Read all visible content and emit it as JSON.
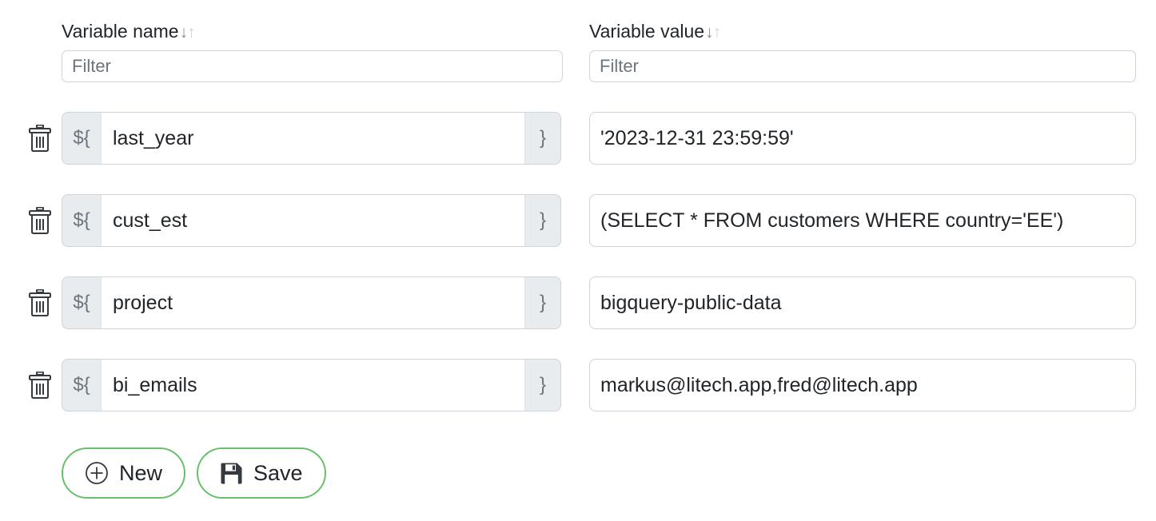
{
  "columns": {
    "name": {
      "header": "Variable name",
      "sort_down": "↓",
      "sort_up": "↑",
      "filter_placeholder": "Filter",
      "filter_value": ""
    },
    "value": {
      "header": "Variable value",
      "sort_down": "↓",
      "sort_up": "↑",
      "filter_placeholder": "Filter",
      "filter_value": ""
    }
  },
  "addons": {
    "prefix": "${",
    "suffix": "}"
  },
  "rows": [
    {
      "delete_icon": "trash-icon",
      "name": "last_year",
      "value": "'2023-12-31 23:59:59'"
    },
    {
      "delete_icon": "trash-icon",
      "name": "cust_est",
      "value": "(SELECT * FROM customers WHERE country='EE')"
    },
    {
      "delete_icon": "trash-icon",
      "name": "project",
      "value": "bigquery-public-data"
    },
    {
      "delete_icon": "trash-icon",
      "name": "bi_emails",
      "value": "markus@litech.app,fred@litech.app"
    }
  ],
  "footer": {
    "new_label": "New",
    "new_icon": "plus-circle-icon",
    "save_label": "Save",
    "save_icon": "floppy-disk-icon"
  },
  "colors": {
    "button_border_green": "#6abf69",
    "addon_background": "#e9ecef",
    "input_border": "#ced4da",
    "placeholder_text": "#6c757d",
    "text": "#212529"
  }
}
